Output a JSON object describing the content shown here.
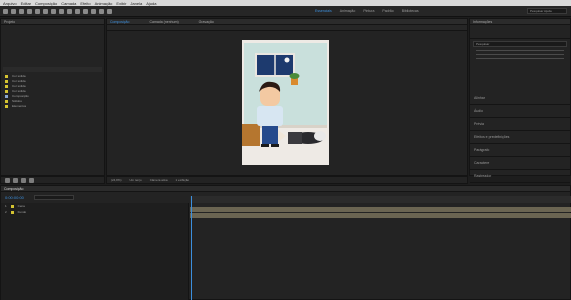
{
  "menu": [
    "Arquivo",
    "Editar",
    "Composição",
    "Camada",
    "Efeito",
    "Animação",
    "Exibir",
    "Janela",
    "Ajuda"
  ],
  "workspace_tabs": [
    {
      "label": "Essenciais",
      "active": true
    },
    {
      "label": "Animação",
      "active": false
    },
    {
      "label": "Pintura",
      "active": false
    },
    {
      "label": "Padrão",
      "active": false
    },
    {
      "label": "Bibliotecas",
      "active": false
    }
  ],
  "search_placeholder": "Pesquisar Ajuda",
  "project_panel": {
    "title": "Projeto",
    "items": [
      {
        "name": "Cor sólida",
        "color": "#d4c331"
      },
      {
        "name": "Cor sólida",
        "color": "#d4c331"
      },
      {
        "name": "Cor sólida",
        "color": "#d4c331"
      },
      {
        "name": "Cor sólida",
        "color": "#d4c331"
      },
      {
        "name": "Composição",
        "color": "#8aa6d1"
      },
      {
        "name": "Sólidos",
        "color": "#d4c331"
      },
      {
        "name": "Elementos",
        "color": "#d4c331"
      }
    ]
  },
  "comp_tab": "Composição",
  "layer_tab": "Camada (nenhum)",
  "footage_tab": "Gravação",
  "right_panel": {
    "title": "Informações",
    "search_placeholder": "Pesquisar",
    "items": [
      "Alinhar",
      "Áudio",
      "Prévia",
      "Efeitos e predefinições",
      "Parágrafo",
      "Caractere",
      "Rastreador"
    ]
  },
  "viewer_controls": {
    "zoom": "(24,8%)",
    "resolution": "Um terço",
    "camera": "Câmera ativa",
    "views": "1 exibição"
  },
  "timeline": {
    "comp_name": "Composição",
    "timecode": "0:00:00:00",
    "layers": [
      {
        "num": "1",
        "name": "Cena",
        "color": "#d4c331"
      },
      {
        "num": "2",
        "name": "Fundo",
        "color": "#d4c331"
      }
    ]
  },
  "colors": {
    "accent": "#3c8fdd",
    "track": "#6b6552",
    "playhead": "#3c8fdd"
  }
}
